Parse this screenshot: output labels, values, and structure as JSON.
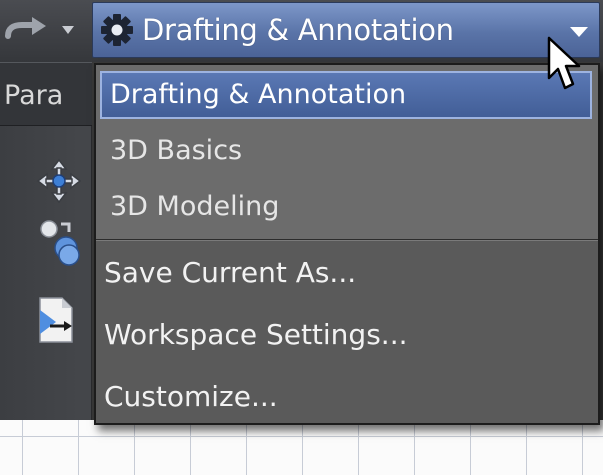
{
  "ribbon": {
    "tab_label": "Para"
  },
  "workspace_switcher": {
    "current": "Drafting & Annotation"
  },
  "workspace_menu": {
    "workspaces": [
      {
        "label": "Drafting & Annotation",
        "selected": true
      },
      {
        "label": "3D Basics",
        "selected": false
      },
      {
        "label": "3D Modeling",
        "selected": false
      }
    ],
    "actions": [
      {
        "label": "Save Current As..."
      },
      {
        "label": "Workspace Settings..."
      },
      {
        "label": "Customize..."
      }
    ]
  },
  "icons": {
    "redo": "redo-icon",
    "quick_access_dropdown": "chevron-down-icon",
    "workspace_gear": "gear-icon",
    "workspace_dropdown": "chevron-down-icon",
    "move_tool": "move-icon",
    "copy_tool": "copy-icon",
    "paste_tool": "paste-icon",
    "cursor": "mouse-pointer-icon"
  },
  "colors": {
    "accent_selected": "#4a66a0",
    "menu_background": "#6c6c6c",
    "toolbar_background": "#3a3a3a",
    "canvas_background": "#fbfbfb",
    "grid_line": "#c7ccd6"
  }
}
